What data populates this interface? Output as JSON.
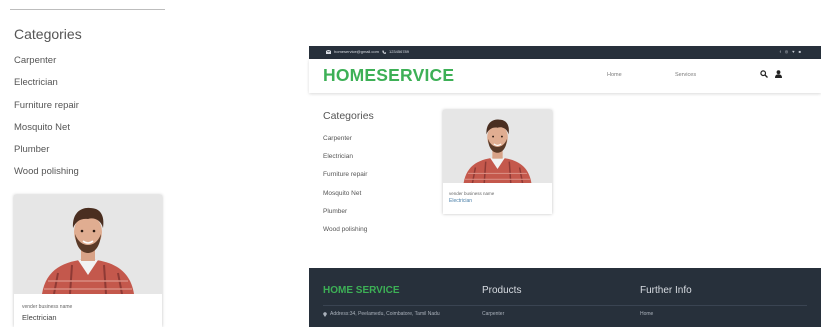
{
  "zoom": {
    "heading": "Categories",
    "categories": [
      "Carpenter",
      "Electrician",
      "Furniture repair",
      "Mosquito Net",
      "Plumber",
      "Wood polishing"
    ],
    "card": {
      "business_name": "vender business name",
      "category": "Electrician"
    }
  },
  "site": {
    "topbar": {
      "email": "homeservice@gmail.com",
      "phone": "123456789",
      "social_icons": [
        "facebook-icon",
        "instagram-icon",
        "twitter-icon",
        "linkedin-icon"
      ]
    },
    "navbar": {
      "brand": "HOMESERVICE",
      "links": [
        "Home",
        "Services"
      ],
      "icons": [
        "search-icon",
        "user-icon"
      ]
    },
    "sidebar": {
      "heading": "Categories",
      "categories": [
        "Carpenter",
        "Electrician",
        "Furniture repair",
        "Mosquito Net",
        "Plumber",
        "Wood polishing"
      ]
    },
    "card": {
      "business_name": "vender business name",
      "category": "Electrician"
    },
    "footer": {
      "brand": "HOME SERVICE",
      "products_heading": "Products",
      "info_heading": "Further Info",
      "address": "Address:34, Peelamedu, Coimbatore, Tamil Nadu",
      "product_link": "Carpenter",
      "info_link": "Home"
    },
    "colors": {
      "brand_green": "#3db056",
      "dark_bar": "#27303b"
    }
  }
}
